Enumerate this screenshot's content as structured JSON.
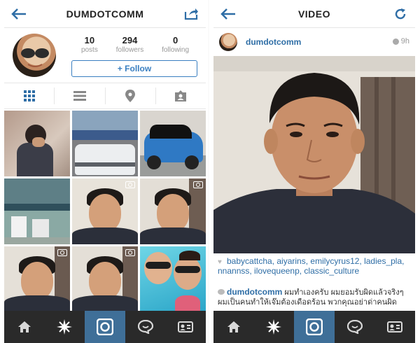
{
  "left_screen": {
    "header": {
      "title": "DUMDOTCOMM",
      "back_icon": "back-arrow-icon",
      "share_icon": "share-icon"
    },
    "profile": {
      "stats": [
        {
          "num": "10",
          "label": "posts"
        },
        {
          "num": "294",
          "label": "followers"
        },
        {
          "num": "0",
          "label": "following"
        }
      ],
      "follow_label": "+ Follow"
    },
    "tabs": [
      "grid-view-icon",
      "list-view-icon",
      "location-icon",
      "tagged-icon"
    ]
  },
  "right_screen": {
    "header": {
      "title": "VIDEO",
      "back_icon": "back-arrow-icon",
      "refresh_icon": "refresh-icon"
    },
    "post": {
      "username": "dumdotcomm",
      "time": "9h",
      "likes_text": "babycattcha, aiyarins, emilycyrus12, ladies_pla, nnannss, ilovequeenp, classic_culture",
      "comment_user": "dumdotcomm",
      "comment_text": "ผมทำเองครับ ผมยอมรับผิดแล้วจริงๆ ผมเป็นคนทำให้เจ๊มต้องเดือดร้อน พวกคุณอย่าด่าคนผิด"
    }
  },
  "tabbar": [
    "home-icon",
    "explore-icon",
    "camera-icon",
    "activity-icon",
    "profile-icon"
  ],
  "colors": {
    "accent": "#3a7fc1",
    "tabbar_bg": "#2a2a2a",
    "tabbar_active": "#3f6f98",
    "link": "#2f6ea6"
  }
}
